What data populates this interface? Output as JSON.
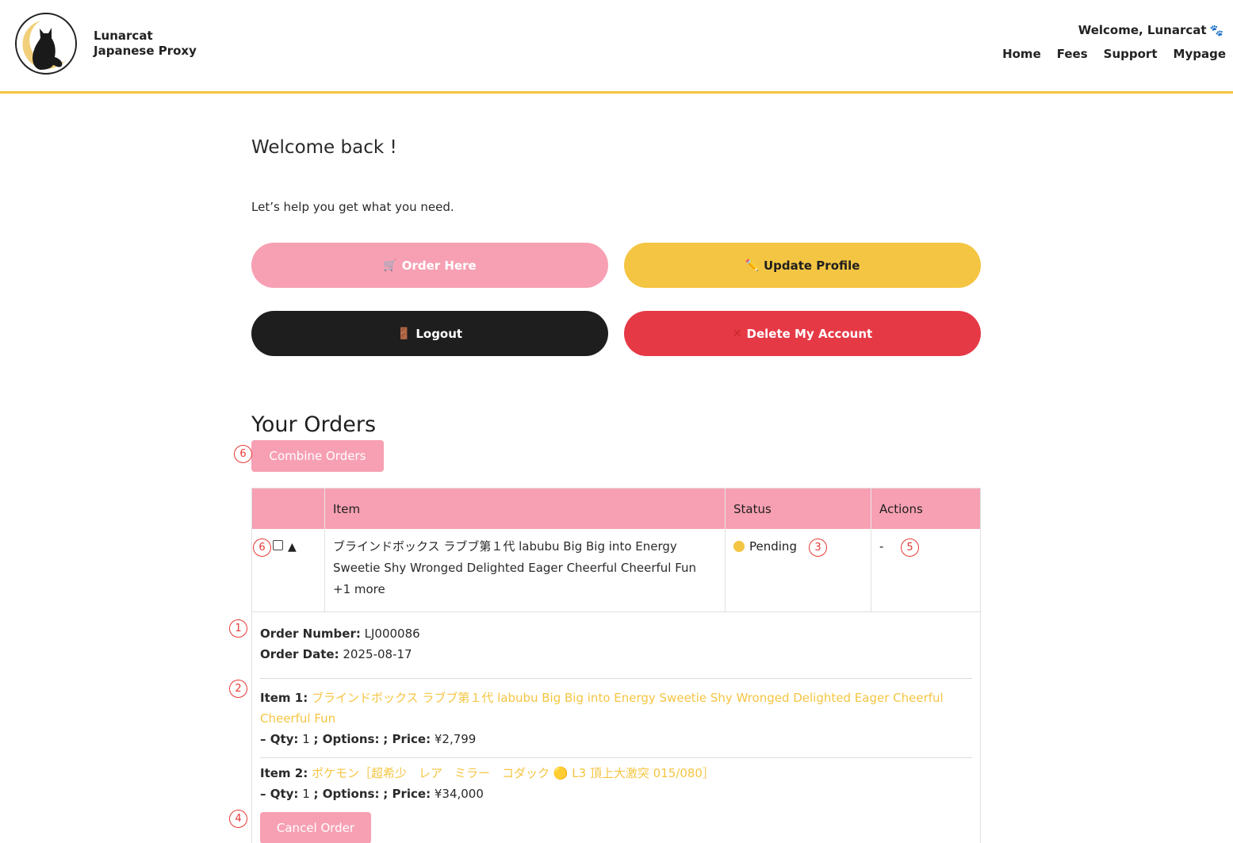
{
  "header": {
    "brand_line1": "Lunarcat",
    "brand_line2": "Japanese Proxy",
    "welcome": "Welcome, Lunarcat",
    "nav": [
      "Home",
      "Fees",
      "Support",
      "Mypage"
    ]
  },
  "main": {
    "title": "Welcome back !",
    "subtitle": "Let’s help you get what you need.",
    "buttons": {
      "order": "Order Here",
      "profile": "Update Profile",
      "logout": "Logout",
      "delete": "Delete My Account"
    },
    "orders_title": "Your Orders",
    "combine_label": "Combine Orders"
  },
  "table": {
    "headers": [
      "",
      "Item",
      "Status",
      "Actions"
    ],
    "row": {
      "item": "ブラインドボックス ラブブ第１代 labubu Big Big into Energy Sweetie Shy Wronged Delighted Eager Cheerful Cheerful Fun +1 more",
      "status": "Pending",
      "actions": "-"
    }
  },
  "details": {
    "order_number_label": "Order Number:",
    "order_number": "LJ000086",
    "order_date_label": "Order Date:",
    "order_date": "2025-08-17",
    "items": [
      {
        "label": "Item 1:",
        "name": "ブラインドボックス ラブブ第１代 labubu Big Big into Energy Sweetie Shy Wronged Delighted Eager Cheerful Cheerful Fun",
        "qty_label": "– Qty:",
        "qty": "1",
        "options_label": "; Options:",
        "options": "",
        "price_label": "; Price:",
        "price": "¥2,799"
      },
      {
        "label": "Item 2:",
        "name": "ポケモン［超希少　レア　ミラー　コダック 🟡 L3 頂上大激突 015/080］",
        "qty_label": "– Qty:",
        "qty": "1",
        "options_label": "; Options:",
        "options": "",
        "price_label": "; Price:",
        "price": "¥34,000"
      }
    ],
    "cancel_label": "Cancel Order"
  },
  "markers": [
    "6",
    "6",
    "3",
    "5",
    "1",
    "2",
    "4"
  ],
  "colors": {
    "pink": "#f7a0b3",
    "yellow": "#f4c542",
    "black": "#1e1e1e",
    "red": "#e63946",
    "marker": "#e53935"
  },
  "icons": {
    "order": "cart-icon",
    "profile": "pencil-icon",
    "logout": "door-icon",
    "delete": "cross-icon",
    "welcome": "paw-icon"
  }
}
